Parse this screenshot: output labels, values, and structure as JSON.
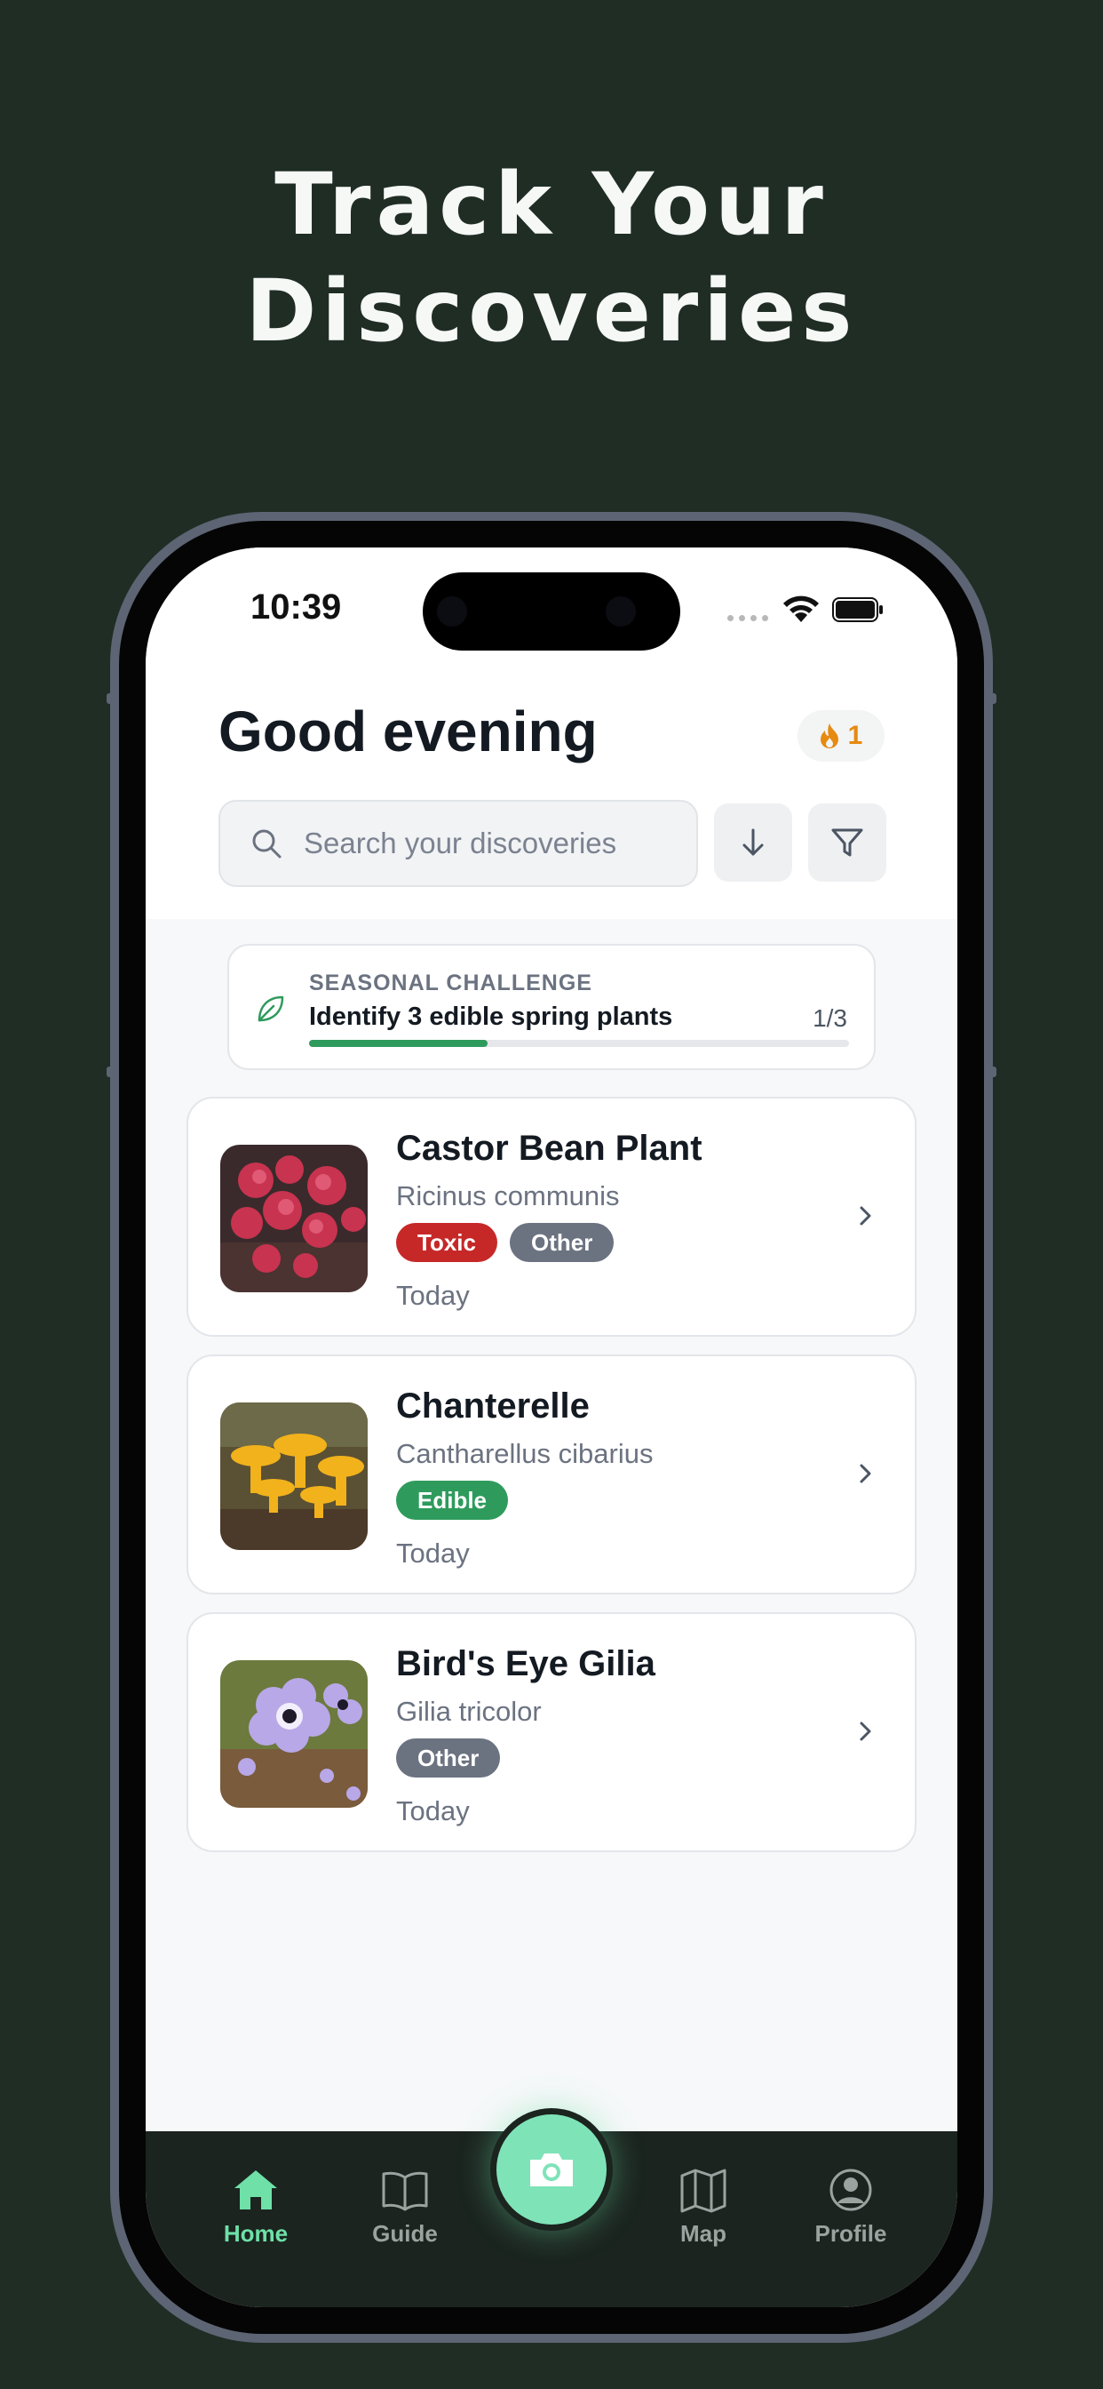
{
  "headline": {
    "line1": "Track Your",
    "line2": "Discoveries"
  },
  "status_bar": {
    "time": "10:39"
  },
  "header": {
    "greeting": "Good evening",
    "streak_count": "1",
    "streak_icon": "flame-icon"
  },
  "search": {
    "placeholder": "Search your discoveries"
  },
  "toolbar": {
    "sort_icon": "arrow-down-icon",
    "filter_icon": "filter-icon"
  },
  "challenge": {
    "label": "SEASONAL CHALLENGE",
    "title": "Identify 3 edible spring plants",
    "progress_text": "1/3",
    "progress_fraction": 0.33,
    "accent": "#2e9b5c"
  },
  "discoveries": [
    {
      "name": "Castor Bean Plant",
      "scientific": "Ricinus communis",
      "badges": [
        {
          "label": "Toxic",
          "color": "#c62828"
        },
        {
          "label": "Other",
          "color": "#6b7280"
        }
      ],
      "date": "Today"
    },
    {
      "name": "Chanterelle",
      "scientific": "Cantharellus cibarius",
      "badges": [
        {
          "label": "Edible",
          "color": "#2e9b5c"
        }
      ],
      "date": "Today"
    },
    {
      "name": "Bird's Eye Gilia",
      "scientific": "Gilia tricolor",
      "badges": [
        {
          "label": "Other",
          "color": "#6b7280"
        }
      ],
      "date": "Today"
    }
  ],
  "nav": {
    "items": [
      {
        "label": "Home",
        "icon": "home-icon",
        "active": true
      },
      {
        "label": "Guide",
        "icon": "book-icon",
        "active": false
      },
      {
        "label": "Map",
        "icon": "map-icon",
        "active": false
      },
      {
        "label": "Profile",
        "icon": "profile-icon",
        "active": false
      }
    ],
    "camera_icon": "camera-icon",
    "active_color": "#6ee0a8"
  }
}
